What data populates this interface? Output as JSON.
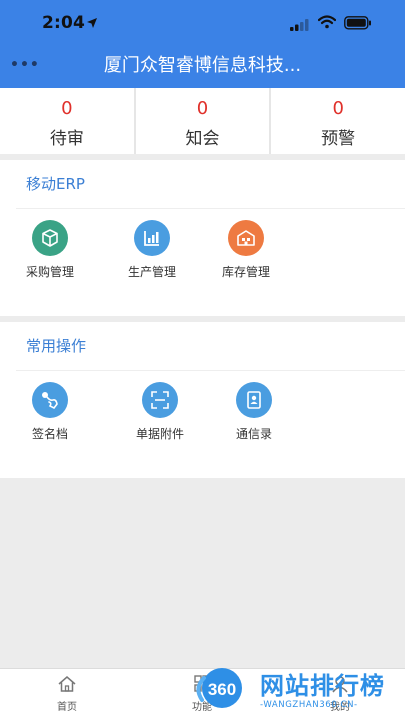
{
  "status_bar": {
    "time": "2:04"
  },
  "header": {
    "title": "厦门众智睿博信息科技..."
  },
  "stats": [
    {
      "count": "0",
      "label": "待审"
    },
    {
      "count": "0",
      "label": "知会"
    },
    {
      "count": "0",
      "label": "预警"
    }
  ],
  "erp": {
    "title": "移动ERP",
    "items": [
      {
        "label": "采购管理",
        "icon": "box-icon",
        "color": "#3aa386"
      },
      {
        "label": "生产管理",
        "icon": "chart-icon",
        "color": "#4a9de0"
      },
      {
        "label": "库存管理",
        "icon": "warehouse-icon",
        "color": "#ee7a41"
      }
    ]
  },
  "ops": {
    "title": "常用操作",
    "items": [
      {
        "label": "签名档",
        "icon": "signature-icon",
        "color": "#4a9de0"
      },
      {
        "label": "单据附件",
        "icon": "scan-icon",
        "color": "#4a9de0"
      },
      {
        "label": "通信录",
        "icon": "contacts-icon",
        "color": "#4a9de0"
      }
    ]
  },
  "bottom_nav": [
    {
      "label": "首页",
      "icon": "home-icon"
    },
    {
      "label": "功能",
      "icon": "grid-icon"
    },
    {
      "label": "我的",
      "icon": "user-icon"
    }
  ],
  "watermark": {
    "badge": "360",
    "title": "网站排行榜",
    "subtitle": "-WANGZHAN360.CN-"
  }
}
